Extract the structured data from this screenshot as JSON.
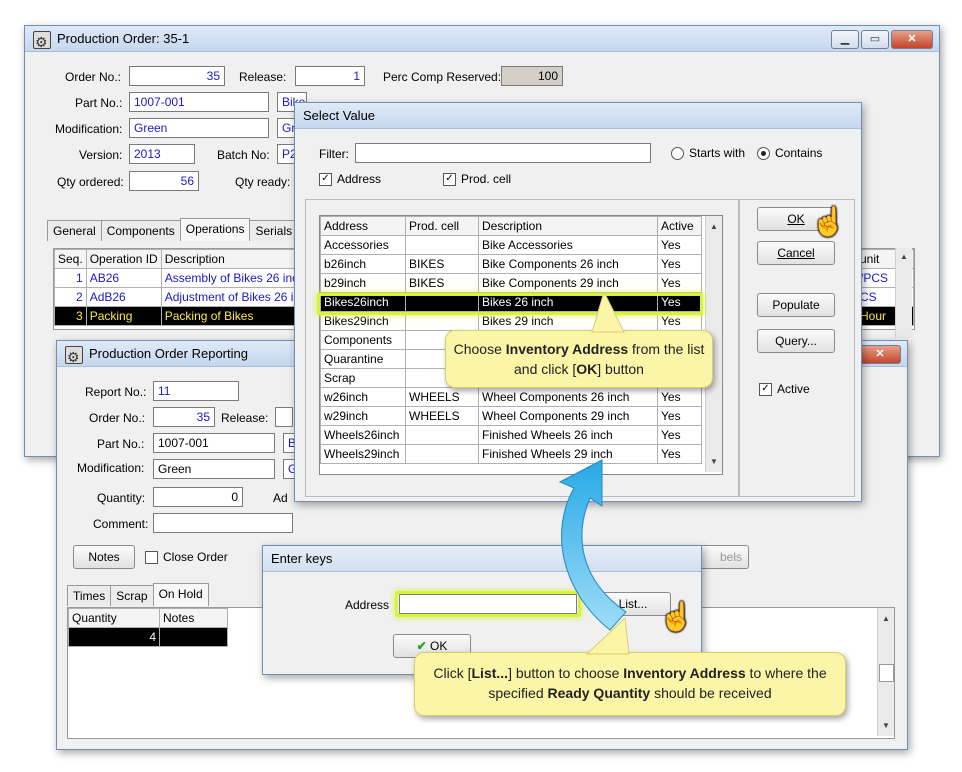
{
  "main_window": {
    "title": "Production Order: 35-1",
    "order_no_label": "Order No.:",
    "order_no": "35",
    "release_label": "Release:",
    "release": "1",
    "perc_label": "Perc Comp Reserved:",
    "perc": "100",
    "part_no_label": "Part No.:",
    "part_no": "1007-001",
    "part_desc": "Bike Scott Volt X",
    "modification_label": "Modification:",
    "modification": "Green",
    "modification_desc": "Gr",
    "version_label": "Version:",
    "version": "2013",
    "batch_label": "Batch No:",
    "batch": "P2",
    "qty_ordered_label": "Qty ordered:",
    "qty_ordered": "56",
    "qty_ready_label": "Qty ready:",
    "tabs": [
      "General",
      "Components",
      "Operations",
      "Serials"
    ],
    "ops_headers": [
      "Seq.",
      "Operation ID",
      "Description"
    ],
    "ops_rows": [
      {
        "seq": "1",
        "id": "AB26",
        "desc": "Assembly of Bikes 26 inch",
        "unit": "/PCS"
      },
      {
        "seq": "2",
        "id": "AdB26",
        "desc": "Adjustment of Bikes 26 in",
        "unit": "CS"
      },
      {
        "seq": "3",
        "id": "Packing",
        "desc": "Packing of Bikes",
        "unit": "Hour"
      }
    ],
    "unit_header": "unit"
  },
  "reporting_window": {
    "title": "Production Order Reporting",
    "report_no_label": "Report No.:",
    "report_no": "11",
    "order_no_label": "Order No.:",
    "order_no": "35",
    "release_label": "Release:",
    "part_no_label": "Part No.:",
    "part_no": "1007-001",
    "part_desc": "B",
    "modification_label": "Modification:",
    "modification": "Green",
    "modification_desc": "G",
    "quantity_label": "Quantity:",
    "quantity": "0",
    "address_label_cut": "Ad",
    "comment_label": "Comment:",
    "notes_button": "Notes",
    "close_order_label": "Close Order",
    "labels_button_cut": "bels",
    "tabs": [
      "Times",
      "Scrap",
      "On Hold"
    ],
    "grid_headers": [
      "Quantity",
      "Notes"
    ],
    "grid_rows": [
      {
        "quantity": "4",
        "notes": ""
      }
    ]
  },
  "select_value": {
    "title": "Select Value",
    "filter_label": "Filter:",
    "filter_value": "",
    "starts_with": "Starts with",
    "contains": "Contains",
    "chk_address": "Address",
    "chk_prodcell": "Prod. cell",
    "headers": [
      "Address",
      "Prod. cell",
      "Description",
      "Active"
    ],
    "rows": [
      {
        "address": "Accessories",
        "cell": "",
        "desc": "Bike Accessories",
        "active": "Yes"
      },
      {
        "address": "b26inch",
        "cell": "BIKES",
        "desc": "Bike Components 26 inch",
        "active": "Yes"
      },
      {
        "address": "b29inch",
        "cell": "BIKES",
        "desc": "Bike Components 29 inch",
        "active": "Yes"
      },
      {
        "address": "Bikes26inch",
        "cell": "",
        "desc": "Bikes 26 inch",
        "active": "Yes"
      },
      {
        "address": "Bikes29inch",
        "cell": "",
        "desc": "Bikes 29 inch",
        "active": "Yes"
      },
      {
        "address": "Components",
        "cell": "",
        "desc": "",
        "active": ""
      },
      {
        "address": "Quarantine",
        "cell": "",
        "desc": "",
        "active": ""
      },
      {
        "address": "Scrap",
        "cell": "",
        "desc": "",
        "active": ""
      },
      {
        "address": "w26inch",
        "cell": "WHEELS",
        "desc": "Wheel Components 26 inch",
        "active": "Yes"
      },
      {
        "address": "w29inch",
        "cell": "WHEELS",
        "desc": "Wheel Components 29 inch",
        "active": "Yes"
      },
      {
        "address": "Wheels26inch",
        "cell": "",
        "desc": "Finished Wheels 26 inch",
        "active": "Yes"
      },
      {
        "address": "Wheels29inch",
        "cell": "",
        "desc": "Finished Wheels 29 inch",
        "active": "Yes"
      }
    ],
    "selected_index": 3,
    "ok": "OK",
    "cancel": "Cancel",
    "populate": "Populate",
    "query": "Query...",
    "active_label": "Active"
  },
  "enter_keys": {
    "title": "Enter keys",
    "address_label": "Address",
    "address_value": "",
    "list_button": "List...",
    "ok": "OK"
  },
  "callout_top": {
    "pre": "Choose ",
    "bold1": "Inventory Address",
    "mid": " from the list and click [",
    "bold2": "OK",
    "post": "] button"
  },
  "callout_bottom": {
    "p1": "Click [",
    "b1": "List...",
    "p2": "] button to choose ",
    "b2": "Inventory Address",
    "p3": " to where the specified ",
    "b3": "Ready Quantity",
    "p4": " should be received"
  }
}
